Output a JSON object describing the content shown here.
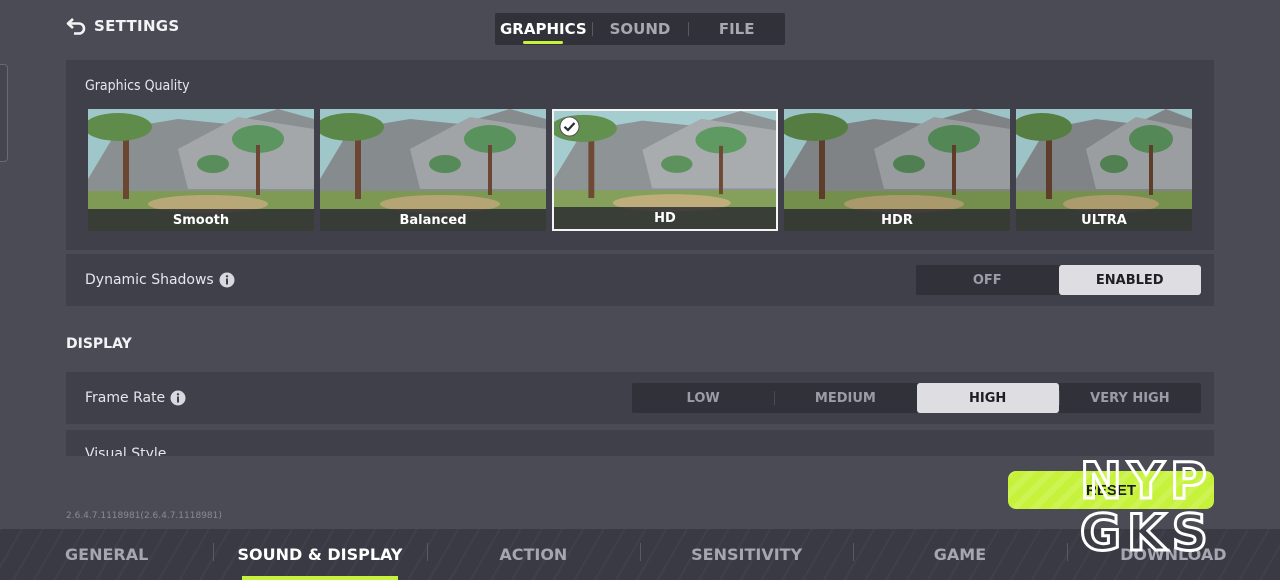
{
  "header": {
    "title": "SETTINGS",
    "tabs": [
      {
        "label": "GRAPHICS",
        "active": true
      },
      {
        "label": "SOUND",
        "active": false
      },
      {
        "label": "FILE",
        "active": false
      }
    ]
  },
  "graphics_quality": {
    "title": "Graphics Quality",
    "presets": [
      {
        "label": "Smooth",
        "selected": false
      },
      {
        "label": "Balanced",
        "selected": false
      },
      {
        "label": "HD",
        "selected": true
      },
      {
        "label": "HDR",
        "selected": false
      },
      {
        "label": "ULTRA",
        "selected": false
      }
    ]
  },
  "dynamic_shadows": {
    "label": "Dynamic Shadows",
    "options": [
      "OFF",
      "ENABLED"
    ],
    "selected": "ENABLED"
  },
  "display": {
    "section_title": "DISPLAY",
    "frame_rate": {
      "label": "Frame Rate",
      "options": [
        "LOW",
        "MEDIUM",
        "HIGH",
        "VERY HIGH"
      ],
      "selected": "HIGH"
    },
    "visual_style": {
      "label": "Visual Style"
    }
  },
  "reset_label": "RESET",
  "version": "2.6.4.7.1118981(2.6.4.7.1118981)",
  "bottom_nav": [
    {
      "label": "GENERAL",
      "active": false
    },
    {
      "label": "SOUND & DISPLAY",
      "active": true
    },
    {
      "label": "ACTION",
      "active": false
    },
    {
      "label": "SENSITIVITY",
      "active": false
    },
    {
      "label": "GAME",
      "active": false
    },
    {
      "label": "DOWNLOAD",
      "active": false
    }
  ],
  "watermark": {
    "line1": "NYP",
    "line2": "GKS"
  },
  "colors": {
    "accent": "#c7f23b",
    "background": "#4b4b56",
    "panel": "#40404b"
  }
}
